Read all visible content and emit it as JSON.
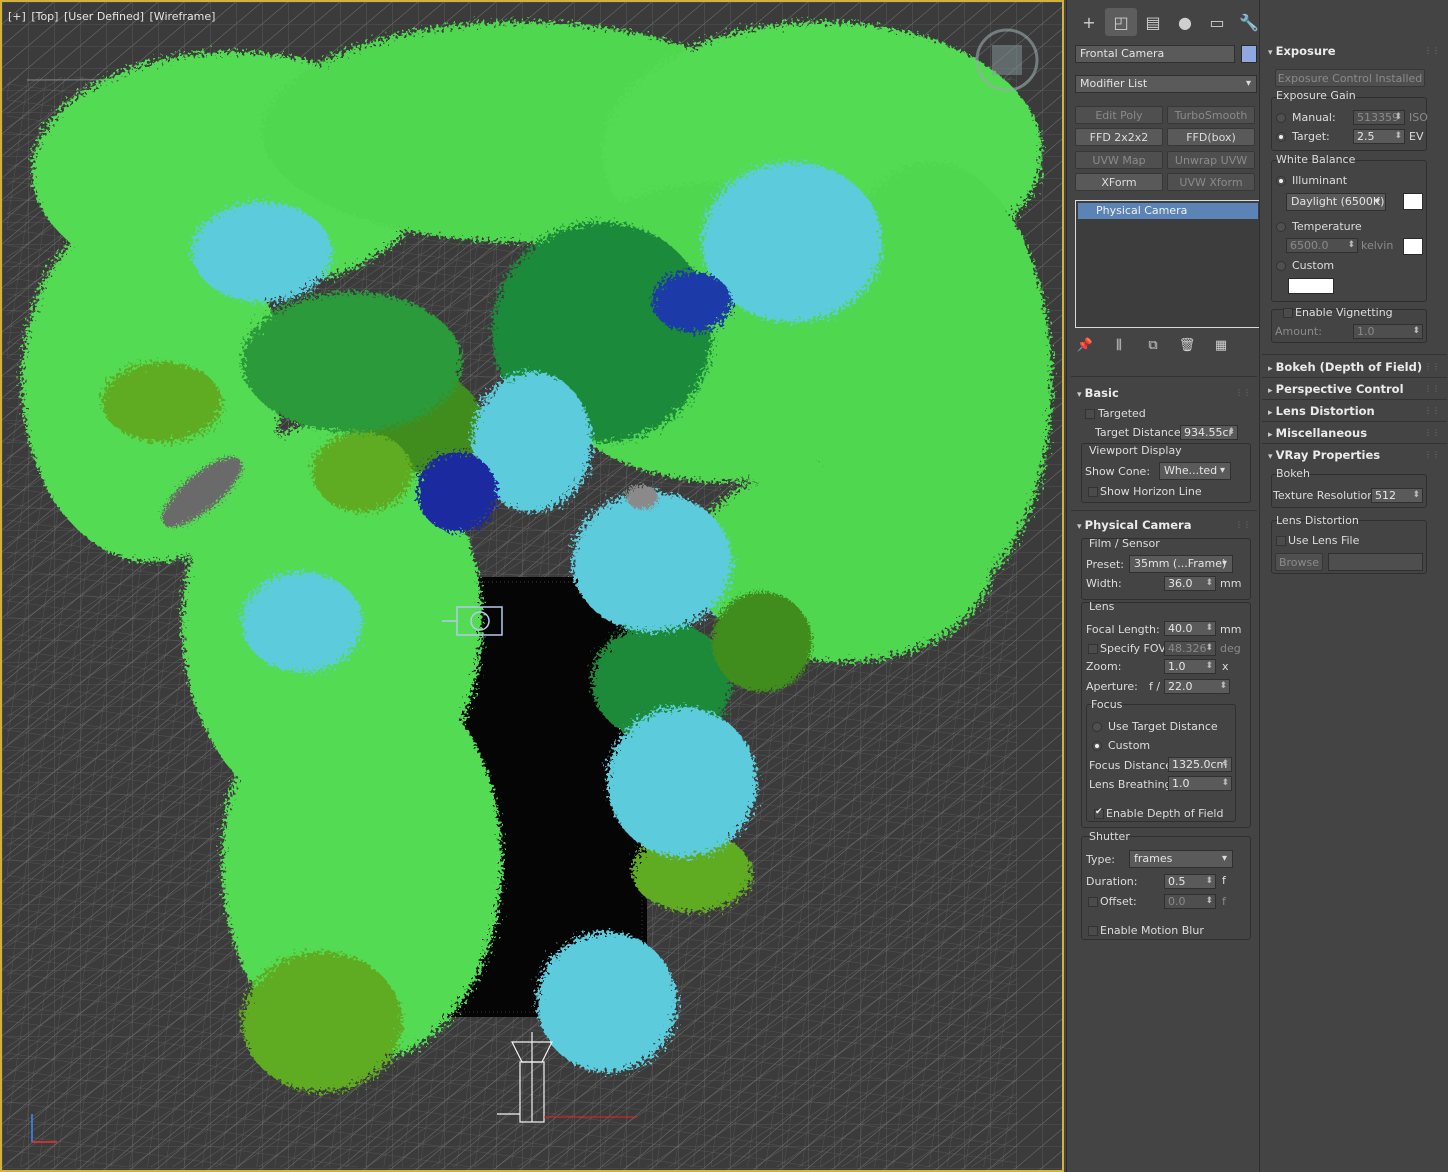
{
  "viewport": {
    "label_parts": [
      "[+]",
      "[Top]",
      "[User Defined]",
      "[Wireframe]"
    ]
  },
  "command_panel": {
    "tab_icons": [
      "create-icon",
      "modify-icon",
      "hierarchy-icon",
      "motion-icon",
      "display-icon",
      "utilities-icon"
    ],
    "tab_glyphs": [
      "+",
      "◰",
      "▤",
      "●",
      "▭",
      "🔧"
    ],
    "object_name": "Frontal Camera",
    "object_color": "#8fa8e0",
    "modifier_list": "Modifier List",
    "modifier_buttons": [
      "Edit Poly",
      "TurboSmooth",
      "FFD 2x2x2",
      "FFD(box)",
      "UVW Map",
      "Unwrap UVW",
      "XForm",
      "UVW Xform"
    ],
    "stack_item": "Physical Camera",
    "basic": {
      "title": "Basic",
      "targeted": "Targeted",
      "target_distance_label": "Target Distance:",
      "target_distance": "934.55cr",
      "viewport_display": "Viewport Display",
      "show_cone_label": "Show Cone:",
      "show_cone": "Whe...ted",
      "show_horizon": "Show Horizon Line"
    },
    "physical_camera": {
      "title": "Physical Camera",
      "film_sensor": "Film / Sensor",
      "preset_label": "Preset:",
      "preset": "35mm (...Frame)",
      "width_label": "Width:",
      "width": "36.0",
      "width_unit": "mm",
      "lens": "Lens",
      "focal_length_label": "Focal Length:",
      "focal_length": "40.0",
      "focal_unit": "mm",
      "specify_fov": "Specify FOV:",
      "fov": "48.326",
      "fov_unit": "deg",
      "zoom_label": "Zoom:",
      "zoom": "1.0",
      "zoom_unit": "x",
      "aperture_label": "Aperture:",
      "aperture_prefix": "f /",
      "aperture": "22.0",
      "focus": "Focus",
      "use_target_distance": "Use Target Distance",
      "custom": "Custom",
      "focus_distance_label": "Focus Distance:",
      "focus_distance": "1325.0cm",
      "lens_breathing_label": "Lens Breathing:",
      "lens_breathing": "1.0",
      "enable_dof": "Enable Depth of Field",
      "shutter": "Shutter",
      "type_label": "Type:",
      "type": "frames",
      "duration_label": "Duration:",
      "duration": "0.5",
      "duration_unit": "f",
      "offset_label": "Offset:",
      "offset": "0.0",
      "offset_unit": "f",
      "enable_motion_blur": "Enable Motion Blur"
    }
  },
  "right_panel": {
    "exposure": {
      "title": "Exposure",
      "installed_button": "Exposure Control Installed",
      "gain_group": "Exposure Gain",
      "manual_label": "Manual:",
      "manual_value": "513359",
      "manual_unit": "ISO",
      "target_label": "Target:",
      "target_value": "2.5",
      "target_unit": "EV",
      "white_balance": "White Balance",
      "illuminant": "Illuminant",
      "illuminant_value": "Daylight (6500K)",
      "temperature": "Temperature",
      "temperature_value": "6500.0",
      "temperature_unit": "kelvin",
      "custom": "Custom",
      "enable_vignetting": "Enable Vignetting",
      "amount_label": "Amount:",
      "amount_value": "1.0"
    },
    "collapsed_rollouts": [
      "Bokeh (Depth of Field)",
      "Perspective Control",
      "Lens Distortion",
      "Miscellaneous"
    ],
    "vray": {
      "title": "VRay Properties",
      "bokeh": "Bokeh",
      "texture_resolution_label": "Texture Resolution",
      "texture_resolution": "512",
      "lens_distortion": "Lens Distortion",
      "use_lens_file": "Use Lens File",
      "browse": "Browse"
    }
  }
}
